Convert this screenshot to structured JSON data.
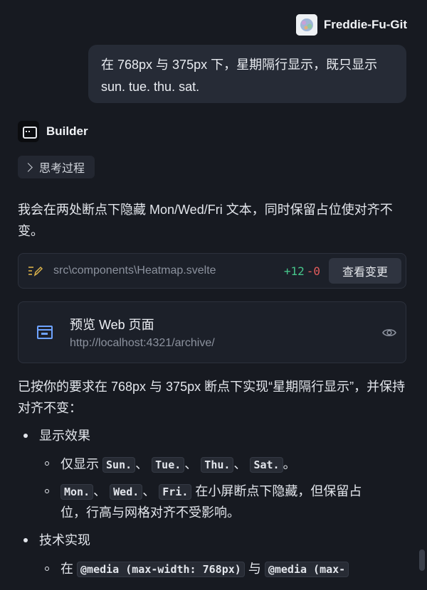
{
  "user": {
    "name": "Freddie-Fu-Git",
    "message": "在 768px 与 375px 下，星期隔行显示，既只显示sun. tue. thu. sat."
  },
  "bot": {
    "name": "Builder",
    "thinking_label": "思考过程"
  },
  "reply_intro": "我会在两处断点下隐藏 Mon/Wed/Fri 文本，同时保留占位使对齐不变。",
  "file_change": {
    "path": "src\\components\\Heatmap.svelte",
    "added": "+12",
    "removed": "-0",
    "view_label": "查看变更"
  },
  "preview": {
    "title": "预览 Web 页面",
    "url": "http://localhost:4321/archive/"
  },
  "summary": "已按你的要求在 768px 与 375px 断点下实现“星期隔行显示”，并保持对齐不变：",
  "bullets": {
    "effect_title": "显示效果",
    "effect_show_prefix": "仅显示",
    "days_shown": [
      "Sun.",
      "Tue.",
      "Thu.",
      "Sat."
    ],
    "sep": "、",
    "end": "。",
    "days_hidden": [
      "Mon.",
      "Wed.",
      "Fri."
    ],
    "hidden_text_1": "在小屏断点下隐藏，但保留占",
    "hidden_text_2": "位，行高与网格对齐不受影响。",
    "tech_title": "技术实现",
    "tech_prefix": "在",
    "media_1": "@media (max-width: 768px)",
    "tech_and": "与",
    "media_2": "@media (max-"
  }
}
